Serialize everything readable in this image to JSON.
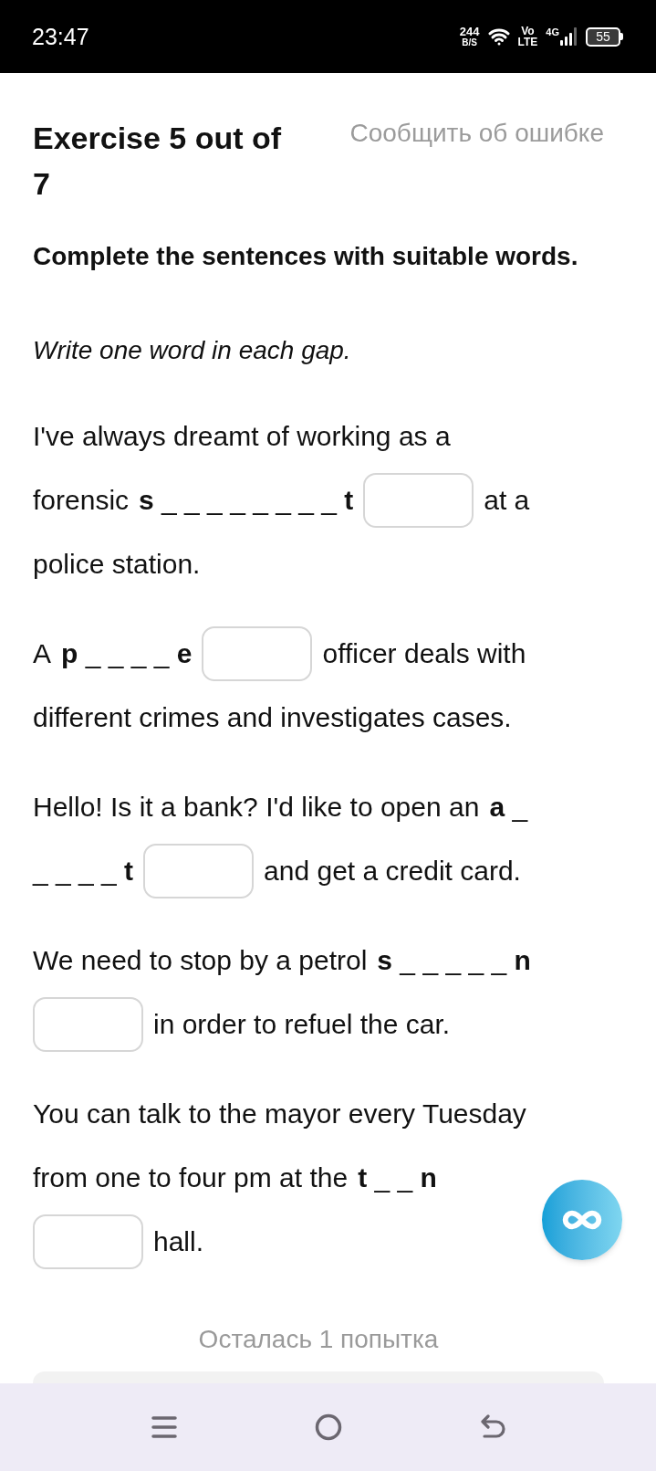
{
  "status_bar": {
    "time": "23:47",
    "net_speed": "244",
    "net_speed_unit": "B/S",
    "volte_top": "Vo",
    "volte_bottom": "LTE",
    "network": "4G",
    "battery": "55"
  },
  "header": {
    "title": "Exercise 5 out of 7",
    "report_link": "Сообщить об ошибке"
  },
  "instruction": "Complete the sentences with suitable words.",
  "note": "Write one word in each gap.",
  "sentences": [
    {
      "lines": [
        [
          {
            "kind": "text",
            "text": "I've always dreamt of working as a"
          }
        ],
        [
          {
            "kind": "text",
            "text": "forensic"
          },
          {
            "kind": "hint",
            "text": "**s** _ _ _ _ _ _ _ _ **t**"
          },
          {
            "kind": "answer_box"
          },
          {
            "kind": "text",
            "text": "at a"
          }
        ],
        [
          {
            "kind": "text",
            "text": "police station."
          }
        ]
      ]
    },
    {
      "lines": [
        [
          {
            "kind": "text",
            "text": "A"
          },
          {
            "kind": "hint",
            "text": "**p** _ _ _ _ **e**"
          },
          {
            "kind": "answer_box"
          },
          {
            "kind": "text",
            "text": "officer deals with"
          }
        ],
        [
          {
            "kind": "text",
            "text": "different crimes and investigates cases."
          }
        ]
      ]
    },
    {
      "lines": [
        [
          {
            "kind": "text",
            "text": "Hello! Is it a bank? I'd like to open an"
          },
          {
            "kind": "hint",
            "text": "**a** _"
          }
        ],
        [
          {
            "kind": "hint",
            "text": "_ _ _ _ **t**"
          },
          {
            "kind": "answer_box"
          },
          {
            "kind": "text",
            "text": "and get a credit card."
          }
        ]
      ]
    },
    {
      "lines": [
        [
          {
            "kind": "text",
            "text": "We need to stop by a petrol"
          },
          {
            "kind": "hint",
            "text": "**s** _ _ _ _ _ **n**"
          }
        ],
        [
          {
            "kind": "answer_box"
          },
          {
            "kind": "text",
            "text": "in order to refuel the car."
          }
        ]
      ]
    },
    {
      "lines": [
        [
          {
            "kind": "text",
            "text": "You can talk to the mayor every Tuesday"
          }
        ],
        [
          {
            "kind": "text",
            "text": "from one to four pm at the"
          },
          {
            "kind": "hint",
            "text": "**t** _ _ **n**"
          }
        ],
        [
          {
            "kind": "answer_box"
          },
          {
            "kind": "text",
            "text": "hall."
          }
        ]
      ]
    }
  ],
  "attempts_left": "Осталась 1 попытка"
}
